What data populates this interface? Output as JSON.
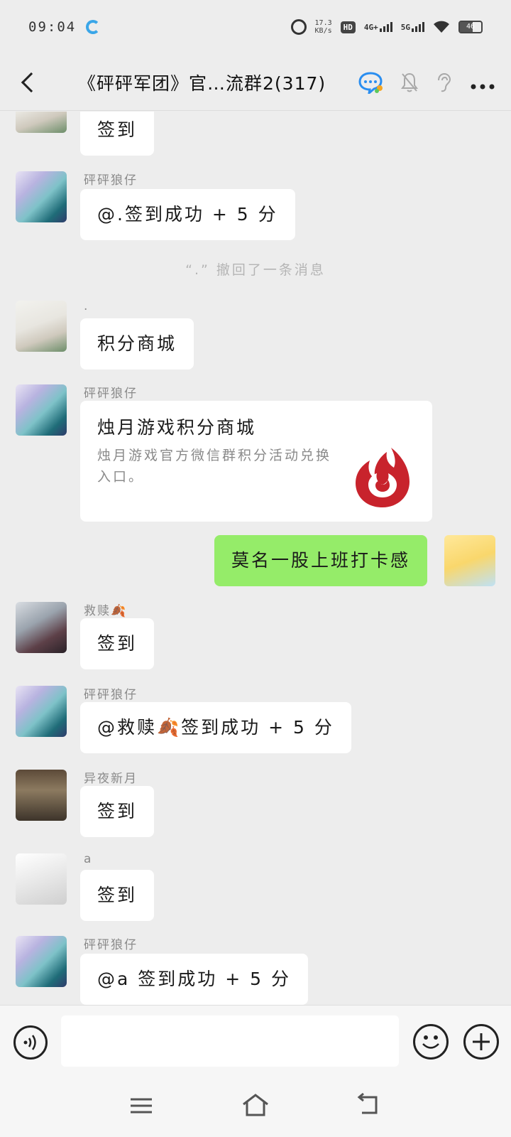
{
  "status_bar": {
    "time": "09:04",
    "net_speed_value": "17.3",
    "net_speed_unit": "KB/s",
    "hd_badge": "HD",
    "network_4g": "4G+",
    "network_5g": "5G",
    "battery": "46"
  },
  "header": {
    "title": "《砰砰军团》官…流群2(317)"
  },
  "messages": [
    {
      "type": "text",
      "sender": "",
      "avatar": "baby-photo-avatar",
      "text": "签到"
    },
    {
      "type": "text",
      "sender": "砰砰狼仔",
      "avatar": "wolf-avatar",
      "text": "@.签到成功 + 5 分"
    },
    {
      "type": "recall",
      "text": "“.” 撤回了一条消息"
    },
    {
      "type": "text",
      "sender": ".",
      "avatar": "baby-photo-avatar",
      "text": "积分商城"
    },
    {
      "type": "card",
      "sender": "砰砰狼仔",
      "avatar": "wolf-avatar",
      "title": "烛月游戏积分商城",
      "desc": "烛月游戏官方微信群积分活动兑换入口。",
      "logo": "candle-flame-logo"
    },
    {
      "type": "self",
      "avatar": "self-avatar",
      "text": "莫名一股上班打卡感"
    },
    {
      "type": "text",
      "sender": "救赎🍂",
      "avatar": "silver-hair-avatar",
      "text": "签到"
    },
    {
      "type": "text",
      "sender": "砰砰狼仔",
      "avatar": "wolf-avatar",
      "text": "@救赎🍂签到成功 + 5 分"
    },
    {
      "type": "text",
      "sender": "异夜新月",
      "avatar": "room-avatar",
      "text": "签到"
    },
    {
      "type": "text",
      "sender": "a",
      "avatar": "anime-avatar",
      "text": "签到"
    },
    {
      "type": "text",
      "sender": "砰砰狼仔",
      "avatar": "wolf-avatar",
      "text": "@a 签到成功 + 5 分"
    }
  ],
  "input": {
    "value": "",
    "placeholder": ""
  },
  "icons": {
    "back": "chevron-left-icon",
    "group_chat": "group-chat-icon",
    "mute": "bell-off-icon",
    "earpiece": "ear-icon",
    "more": "more-horizontal-icon",
    "voice": "voice-icon",
    "emoji": "emoji-icon",
    "plus": "plus-icon",
    "nav_menu": "menu-icon",
    "nav_home": "home-icon",
    "nav_back": "back-icon"
  },
  "colors": {
    "background": "#ededed",
    "bubble_other": "#ffffff",
    "bubble_self": "#95ec69",
    "sender_text": "#8a8a8a"
  }
}
